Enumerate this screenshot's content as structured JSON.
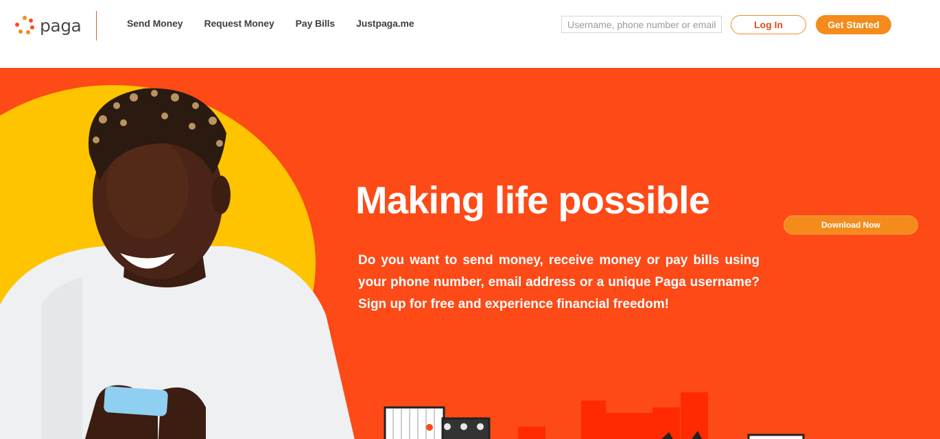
{
  "brand": {
    "name": "paga",
    "colors": {
      "primary": "#fd4a17",
      "accent": "#f58b1b",
      "yellow": "#ffc400"
    }
  },
  "nav": {
    "items": [
      {
        "label": "Send Money"
      },
      {
        "label": "Request Money"
      },
      {
        "label": "Pay Bills"
      },
      {
        "label": "Justpaga.me"
      }
    ]
  },
  "search": {
    "placeholder": "Username, phone number or email",
    "value": ""
  },
  "auth": {
    "login_label": "Log In",
    "get_started_label": "Get Started"
  },
  "hero": {
    "title": "Making life possible",
    "description": "Do you want to send money, receive money or pay bills using your phone number, email address or a unique Paga username? Sign up for free and experience financial freedom!",
    "download_label": "Download Now"
  }
}
